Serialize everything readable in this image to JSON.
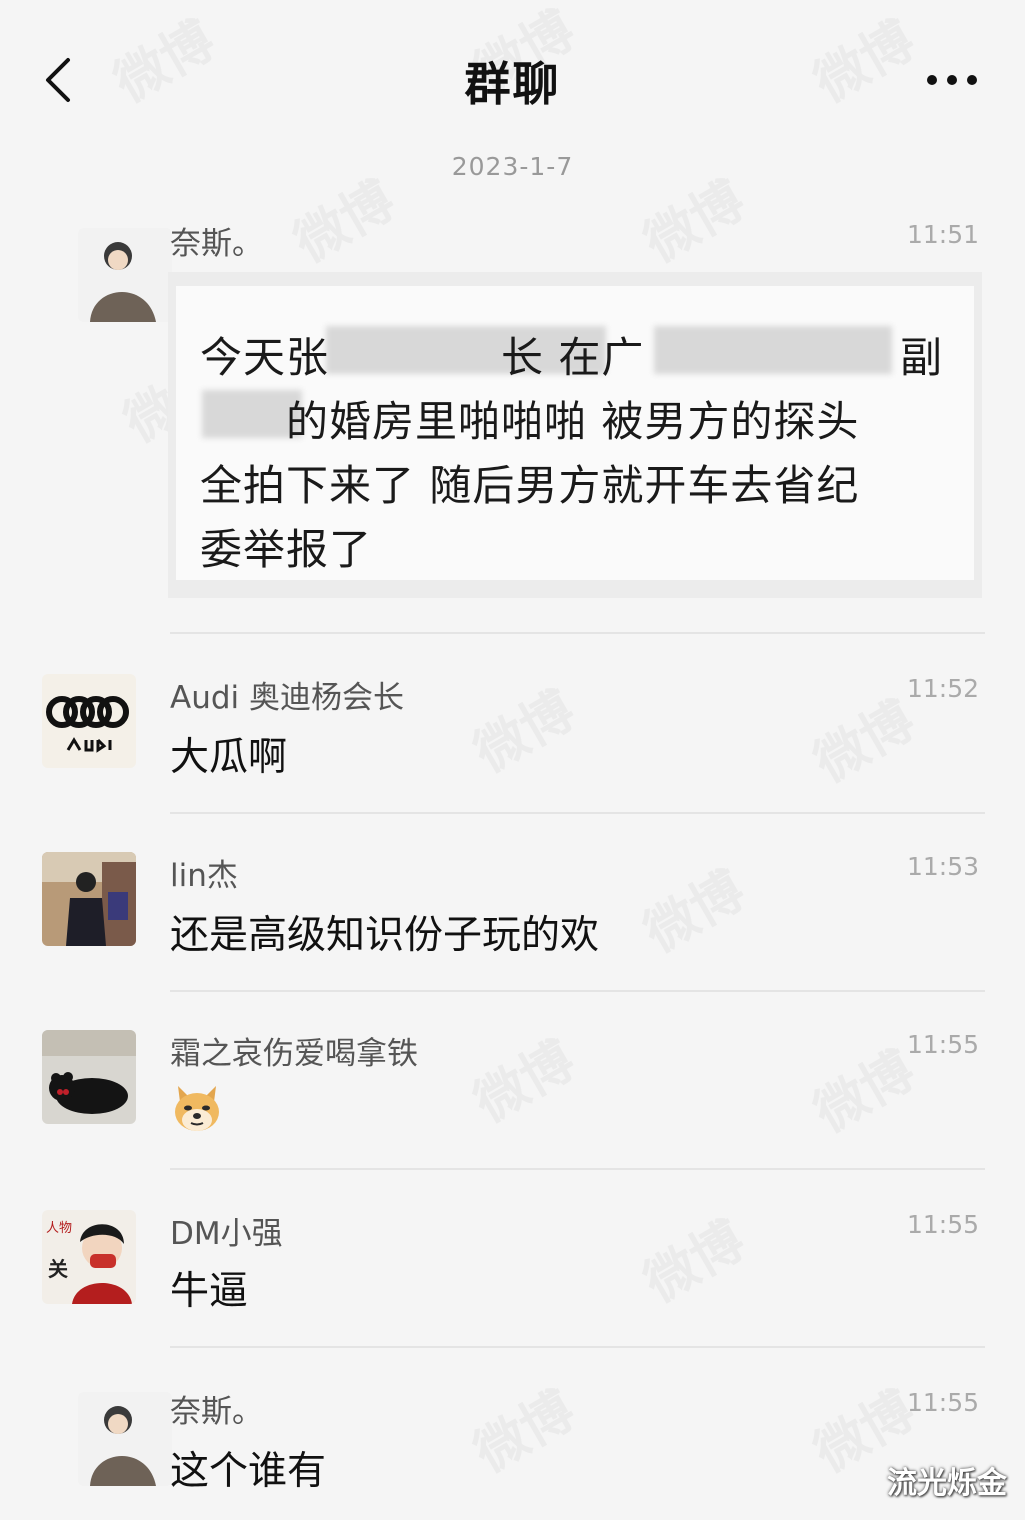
{
  "header": {
    "title": "群聊",
    "back_icon": "chevron-left-icon",
    "more_icon": "ellipsis-icon"
  },
  "date_label": "2023-1-7",
  "messages": [
    {
      "sender": "奈斯。",
      "time": "11:51",
      "quote_lines": [
        "今天张　　　　长 在广",
        "　　的婚房里啪啪啪 被男方的探头",
        "全拍下来了 随后男方就开车去省纪",
        "委举报了"
      ],
      "quote_fragment_right": "副"
    },
    {
      "sender": "Audi 奥迪杨会长",
      "time": "11:52",
      "text": "大瓜啊"
    },
    {
      "sender": "lin杰",
      "time": "11:53",
      "text": "还是高级知识份子玩的欢"
    },
    {
      "sender": "霜之哀伤爱喝拿铁",
      "time": "11:55",
      "emoji": "doge-emoji"
    },
    {
      "sender": "DM小强",
      "time": "11:55",
      "text": "牛逼"
    },
    {
      "sender": "奈斯。",
      "time": "11:55",
      "text": "这个谁有"
    }
  ],
  "watermark": "微博",
  "corner_mark": "流光烁金",
  "colors": {
    "background": "#f5f5f5",
    "text": "#111111",
    "time": "#aaaaaa"
  }
}
